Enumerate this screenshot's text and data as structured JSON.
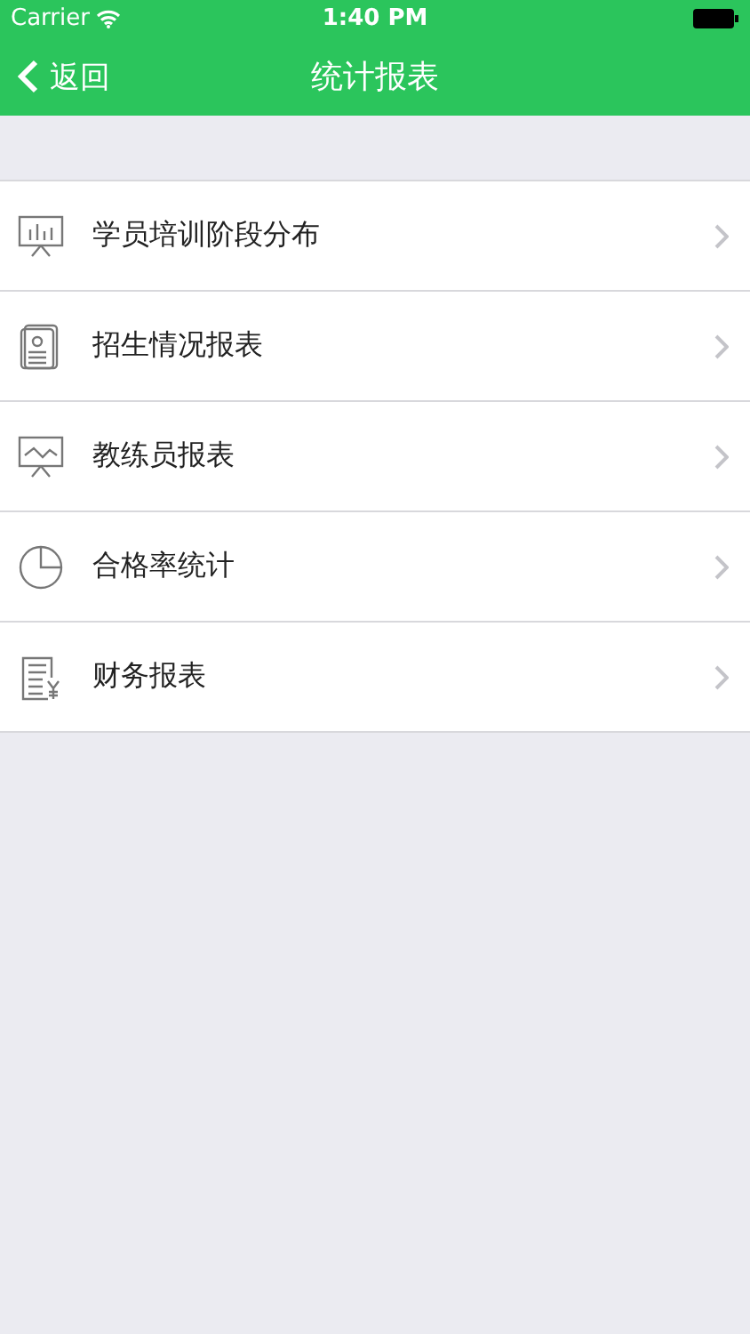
{
  "status_bar": {
    "carrier": "Carrier",
    "time": "1:40 PM"
  },
  "nav": {
    "back": "返回",
    "title": "统计报表"
  },
  "items": [
    {
      "kind": "board-bars",
      "label": "学员培训阶段分布"
    },
    {
      "kind": "id-card",
      "label": "招生情况报表"
    },
    {
      "kind": "board-line",
      "label": "教练员报表"
    },
    {
      "kind": "pie",
      "label": "合格率统计"
    },
    {
      "kind": "invoice",
      "label": "财务报表"
    }
  ]
}
